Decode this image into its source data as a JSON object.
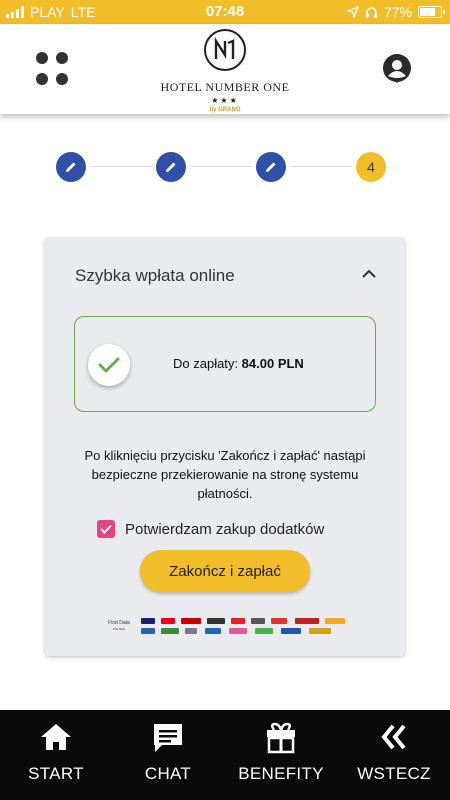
{
  "status_bar": {
    "carrier": "PLAY",
    "network": "LTE",
    "time": "07:48",
    "battery_percent": "77%",
    "battery_level": 0.77
  },
  "header": {
    "logo_monogram": "N1",
    "hotel_name": "HOTEL NUMBER ONE",
    "stars": "★★★",
    "brand_line": "by GRANO"
  },
  "stepper": {
    "steps": [
      {
        "state": "done",
        "icon": "pencil-icon"
      },
      {
        "state": "done",
        "icon": "pencil-icon"
      },
      {
        "state": "done",
        "icon": "pencil-icon"
      },
      {
        "state": "current",
        "label": "4"
      }
    ]
  },
  "payment_card": {
    "title": "Szybka wpłata online",
    "amount_label": "Do zapłaty:",
    "amount_value": "84.00 PLN",
    "info_text": "Po kliknięciu przycisku 'Zakończ i zapłać' nastąpi bezpieczne przekierowanie na stronę systemu płatności.",
    "confirm_label": "Potwierdzam zakup dodatków",
    "confirm_checked": true,
    "pay_button_label": "Zakończ i zapłać",
    "provider_logo_text": "First Data"
  },
  "bottom_nav": {
    "items": [
      {
        "label": "START",
        "icon": "home-icon"
      },
      {
        "label": "CHAT",
        "icon": "chat-icon"
      },
      {
        "label": "BENEFITY",
        "icon": "gift-icon"
      },
      {
        "label": "WSTECZ",
        "icon": "back-chevrons-icon"
      }
    ]
  },
  "colors": {
    "accent_yellow": "#f2bd2b",
    "step_blue": "#2f50a6",
    "success_green": "#6aa84f",
    "checkbox_pink": "#e0457b",
    "nav_bg": "#0a0a0a"
  }
}
